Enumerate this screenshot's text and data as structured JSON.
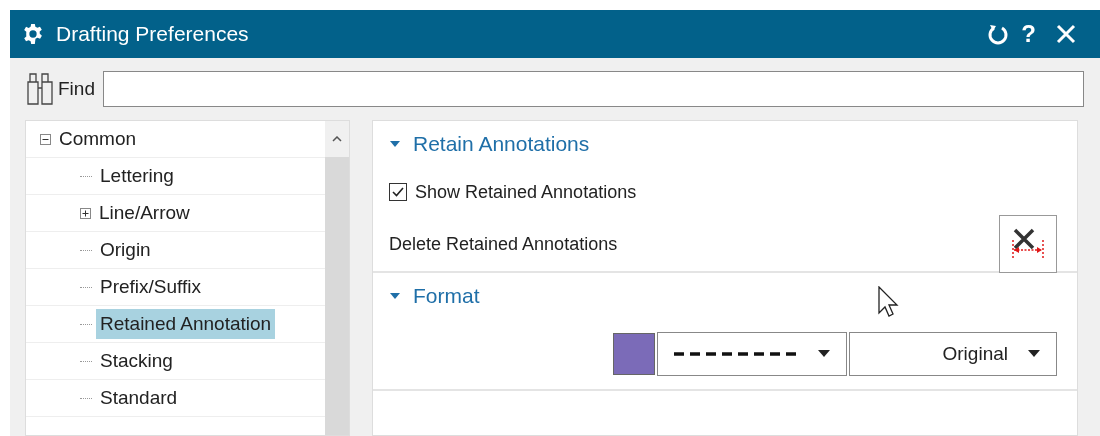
{
  "window": {
    "title": "Drafting Preferences",
    "controls": [
      "?"
    ]
  },
  "find": {
    "label": "Find"
  },
  "tree": [
    {
      "label": "Common",
      "expanded": true,
      "selected": false,
      "children": [
        {
          "label": "Lettering",
          "selected": false
        },
        {
          "label": "Line/Arrow",
          "expanded": false,
          "selected": false
        },
        {
          "label": "Origin",
          "selected": false
        },
        {
          "label": "Prefix/Suffix",
          "selected": false
        },
        {
          "label": "Retained Annotation",
          "selected": true
        },
        {
          "label": "Stacking",
          "selected": false
        },
        {
          "label": "Standard",
          "selected": false
        }
      ]
    }
  ],
  "sections": [
    {
      "title": "Retain Annotations",
      "expanded": true,
      "rows": [
        {
          "kind": "checkbox",
          "label": "Show Retained Annotations",
          "checked": true
        },
        {
          "kind": "action",
          "label": "Delete Retained Annotations"
        }
      ]
    },
    {
      "title": "Format",
      "expanded": true,
      "rows": [
        {
          "kind": "format",
          "color": "#7b6bb8",
          "width": "Original"
        }
      ]
    }
  ]
}
